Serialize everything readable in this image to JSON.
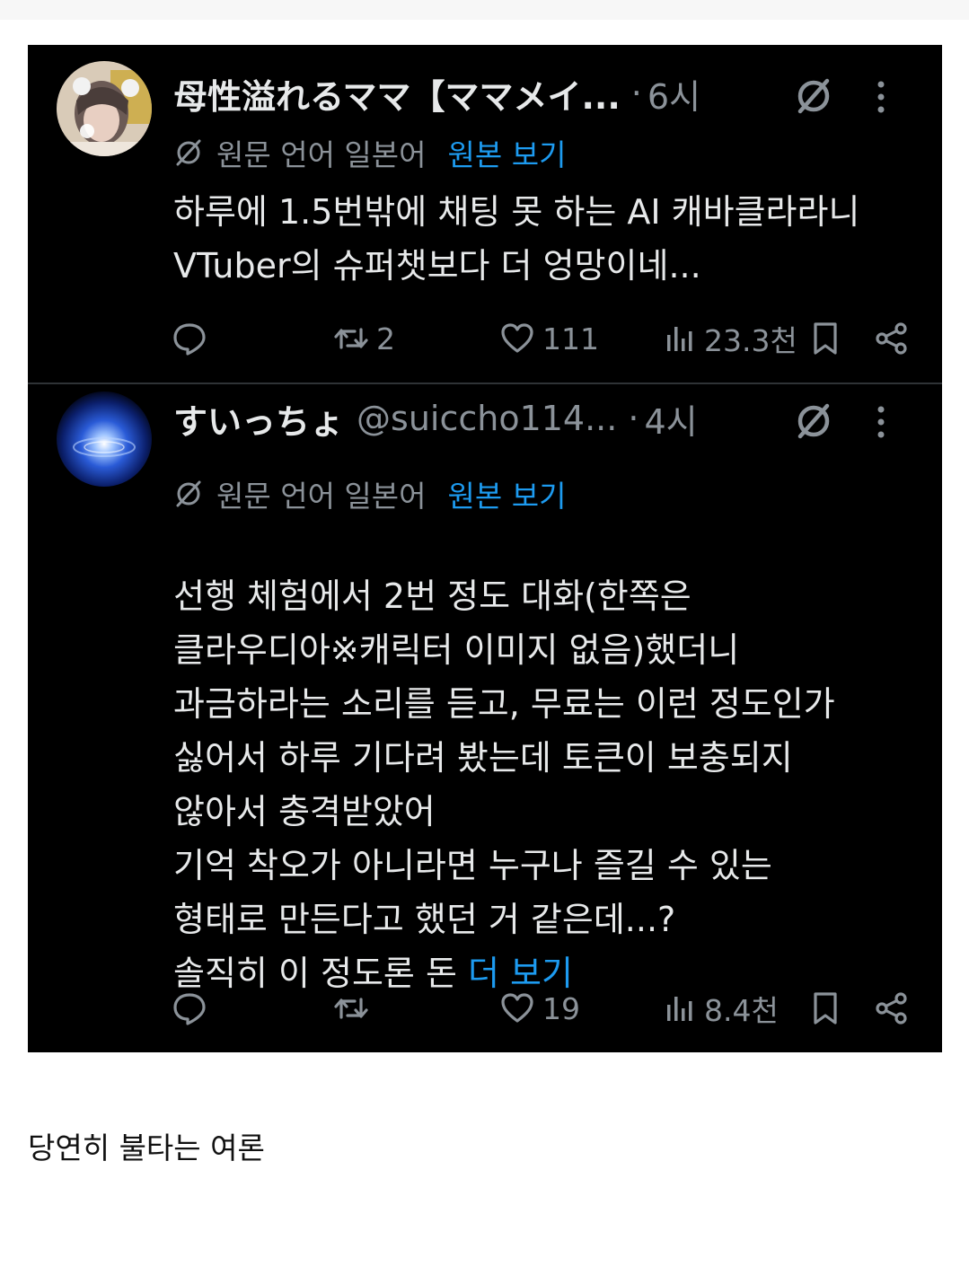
{
  "posts": [
    {
      "display_name": "母性溢れるママ【ママメイ...",
      "handle": "",
      "dot": "·",
      "time": "6시",
      "avatar_icon": "avatar-photo",
      "translation": {
        "label": "원문 언어 일본어",
        "link": "원본 보기"
      },
      "body_lines": [
        "하루에 1.5번밖에 채팅 못 하는 AI 캐바클라라니",
        "VTuber의 슈퍼챗보다 더 엉망이네..."
      ],
      "more_link": "",
      "stats": {
        "replies": "",
        "reposts": "2",
        "likes": "111",
        "views": "23.3천"
      }
    },
    {
      "display_name": "すいっちょ",
      "handle": "@suiccho114...",
      "dot": "·",
      "time": "4시",
      "avatar_icon": "avatar-galaxy",
      "translation": {
        "label": "원문 언어 일본어",
        "link": "원본 보기"
      },
      "body_lines": [
        "선행 체험에서 2번 정도 대화(한쪽은",
        "클라우디아※캐릭터 이미지 없음)했더니",
        "과금하라는 소리를 듣고, 무료는 이런 정도인가",
        "싫어서 하루 기다려 봤는데 토큰이 보충되지",
        "않아서 충격받았어",
        "기억 착오가 아니라면 누구나 즐길 수 있는",
        "형태로 만든다고 했던 거 같은데...?",
        "솔직히 이 정도론 돈 "
      ],
      "more_link": "더 보기",
      "stats": {
        "replies": "",
        "reposts": "",
        "likes": "19",
        "views": "8.4천"
      }
    }
  ],
  "caption": "당연히 불타는 여론",
  "colors": {
    "background": "#000000",
    "text": "#e7e9ea",
    "muted": "#8b9299",
    "link": "#1d9bf0",
    "page": "#ffffff"
  }
}
